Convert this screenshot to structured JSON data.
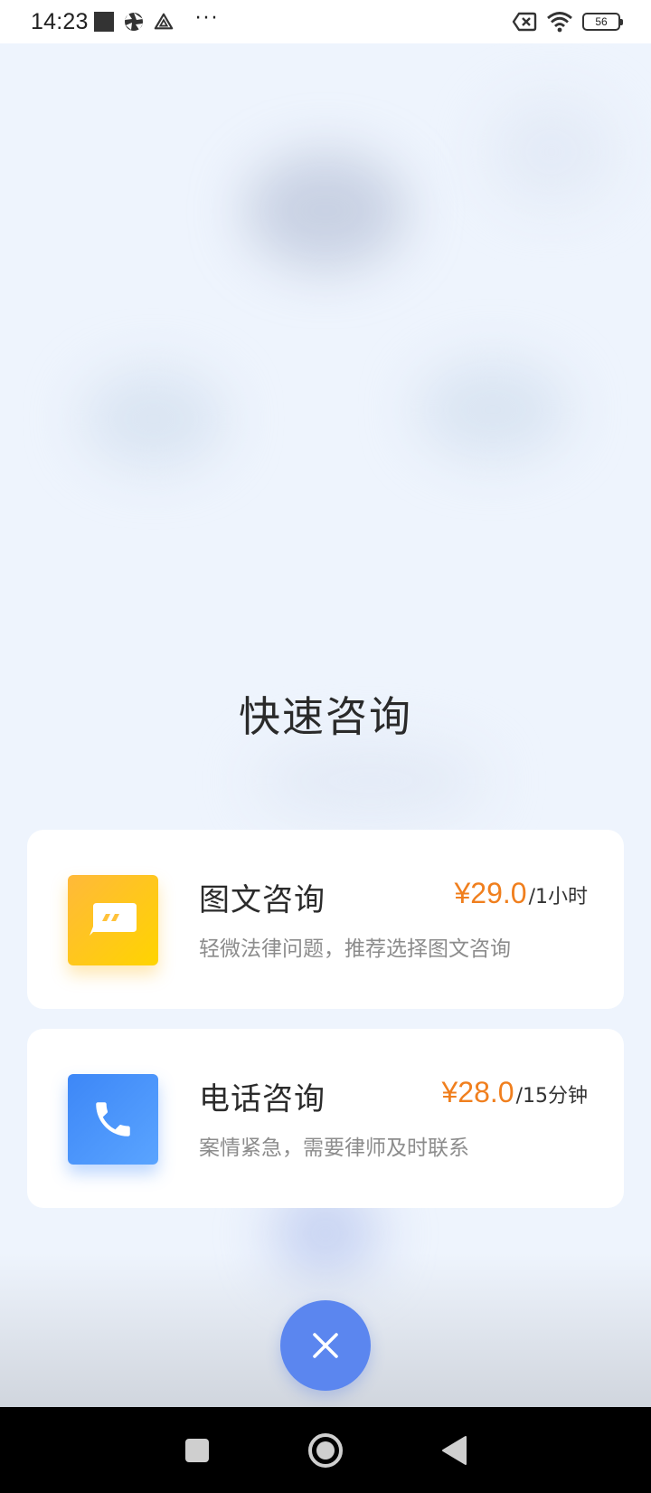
{
  "status_bar": {
    "time": "14:23",
    "battery": "56"
  },
  "title": "快速咨询",
  "options": [
    {
      "name": "图文咨询",
      "price": "¥29.0",
      "unit": "/1小时",
      "description": "轻微法律问题，推荐选择图文咨询",
      "icon": "chat-bubble-icon",
      "color": "#ffc81e"
    },
    {
      "name": "电话咨询",
      "price": "¥28.0",
      "unit": "/15分钟",
      "description": "案情紧急，需要律师及时联系",
      "icon": "phone-icon",
      "color": "#4d93fb"
    }
  ],
  "colors": {
    "price": "#f07f1e",
    "close_button": "#5b86ef",
    "background": "#eef4fd"
  },
  "nav_bar": {
    "icons": [
      "recent-apps-icon",
      "home-icon",
      "back-icon"
    ]
  }
}
